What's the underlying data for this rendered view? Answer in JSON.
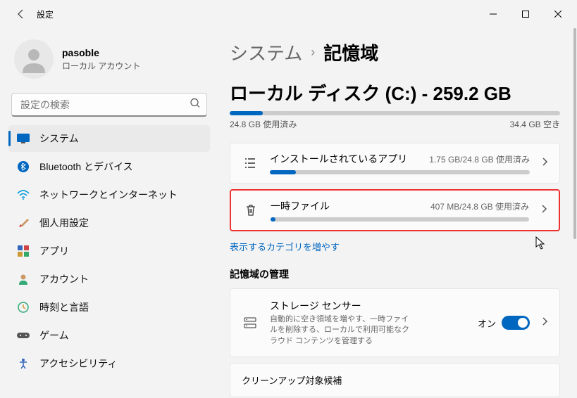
{
  "window": {
    "title": "設定"
  },
  "user": {
    "name": "pasoble",
    "sub": "ローカル アカウント"
  },
  "search": {
    "placeholder": "設定の検索"
  },
  "nav": {
    "system": "システム",
    "bluetooth": "Bluetooth とデバイス",
    "network": "ネットワークとインターネット",
    "personalization": "個人用設定",
    "apps": "アプリ",
    "accounts": "アカウント",
    "time": "時刻と言語",
    "gaming": "ゲーム",
    "accessibility": "アクセシビリティ"
  },
  "breadcrumb": {
    "parent": "システム",
    "sep": "›",
    "current": "記憶域"
  },
  "disk": {
    "title": "ローカル ディスク (C:) - 259.2 GB",
    "used": "24.8 GB 使用済み",
    "free": "34.4 GB 空き",
    "fillPct": "10%"
  },
  "categories": {
    "apps": {
      "title": "インストールされているアプリ",
      "sub": "1.75 GB/24.8 GB 使用済み",
      "fillPct": "10%"
    },
    "temp": {
      "title": "一時ファイル",
      "sub": "407 MB/24.8 GB 使用済み",
      "fillPct": "2%"
    }
  },
  "moreLink": "表示するカテゴリを増やす",
  "section": {
    "manage": "記憶域の管理"
  },
  "sense": {
    "title": "ストレージ センサー",
    "desc": "自動的に空き領域を増やす、一時ファイルを削除する、ローカルで利用可能なクラウド コンテンツを管理する",
    "toggleLabel": "オン"
  },
  "cleanup": {
    "title": "クリーンアップ対象候補"
  }
}
